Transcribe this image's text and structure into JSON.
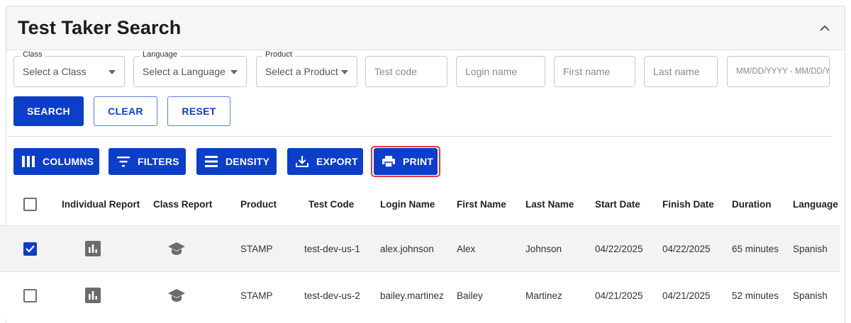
{
  "header": {
    "title": "Test Taker Search",
    "collapse_icon": "chevron-up-icon"
  },
  "filters": {
    "class": {
      "label": "Class",
      "value": "Select a Class"
    },
    "language": {
      "label": "Language",
      "value": "Select a Language"
    },
    "product": {
      "label": "Product",
      "value": "Select a Product"
    },
    "test_code": {
      "placeholder": "Test code"
    },
    "login_name": {
      "placeholder": "Login name"
    },
    "first_name": {
      "placeholder": "First name"
    },
    "last_name": {
      "placeholder": "Last name"
    },
    "date_range": {
      "placeholder": "MM/DD/YYYY - MM/DD/YYYY"
    }
  },
  "actions": {
    "search": "SEARCH",
    "clear": "CLEAR",
    "reset": "RESET"
  },
  "toolbar": {
    "columns": "COLUMNS",
    "filters": "FILTERS",
    "density": "DENSITY",
    "export": "EXPORT",
    "print": "PRINT"
  },
  "table": {
    "columns": [
      "Individual Report",
      "Class Report",
      "Product",
      "Test Code",
      "Login Name",
      "First Name",
      "Last Name",
      "Start Date",
      "Finish Date",
      "Duration",
      "Language"
    ],
    "rows": [
      {
        "selected": true,
        "product": "STAMP",
        "test_code": "test-dev-us-1",
        "login_name": "alex.johnson",
        "first_name": "Alex",
        "last_name": "Johnson",
        "start_date": "04/22/2025",
        "finish_date": "04/22/2025",
        "duration": "65 minutes",
        "language": "Spanish"
      },
      {
        "selected": false,
        "product": "STAMP",
        "test_code": "test-dev-us-2",
        "login_name": "bailey.martinez",
        "first_name": "Bailey",
        "last_name": "Martinez",
        "start_date": "04/21/2025",
        "finish_date": "04/21/2025",
        "duration": "52 minutes",
        "language": "Spanish"
      }
    ]
  },
  "colors": {
    "primary": "#0d3ec9",
    "highlight": "#e23a3a",
    "icon_gray": "#6b6b6b"
  }
}
